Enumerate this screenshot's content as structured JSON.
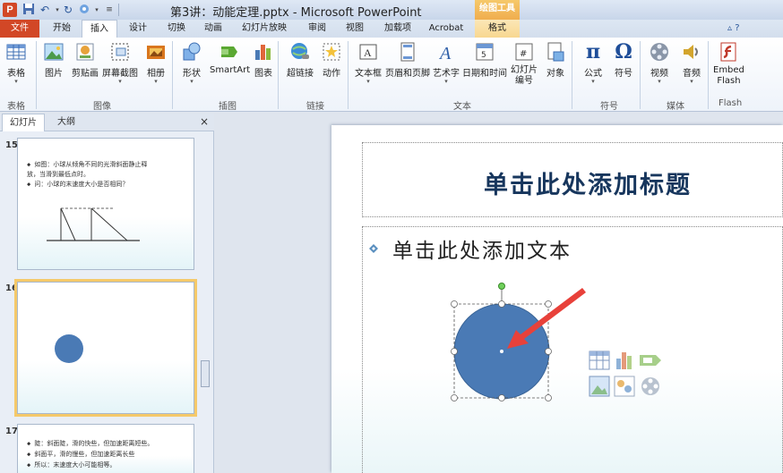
{
  "titlebar": {
    "title": "第3讲：动能定理.pptx - Microsoft PowerPoint",
    "context_group": "绘图工具"
  },
  "tabs": [
    {
      "label": "文件"
    },
    {
      "label": "开始"
    },
    {
      "label": "插入"
    },
    {
      "label": "设计"
    },
    {
      "label": "切换"
    },
    {
      "label": "动画"
    },
    {
      "label": "幻灯片放映"
    },
    {
      "label": "审阅"
    },
    {
      "label": "视图"
    },
    {
      "label": "加载项"
    },
    {
      "label": "Acrobat"
    },
    {
      "label": "格式"
    }
  ],
  "ribbon": {
    "buttons": {
      "table": "表格",
      "picture": "图片",
      "clipart": "剪贴画",
      "screenshot": "屏幕截图",
      "album": "相册",
      "shapes": "形状",
      "smartart": "SmartArt",
      "chart": "图表",
      "hyperlink": "超链接",
      "action": "动作",
      "textbox": "文本框",
      "headerfooter": "页眉和页脚",
      "wordart": "艺术字",
      "datetime": "日期和时间",
      "slidenum_1": "幻灯片",
      "slidenum_2": "编号",
      "object": "对象",
      "equation": "公式",
      "symbol": "符号",
      "video": "视频",
      "audio": "音频",
      "embed_1": "Embed",
      "embed_2": "Flash"
    },
    "groups": {
      "tables": "表格",
      "images": "图像",
      "illustrations": "插图",
      "links": "链接",
      "text": "文本",
      "symbols": "符号",
      "media": "媒体",
      "flash": "Flash"
    }
  },
  "leftpanel": {
    "tabs": {
      "slides": "幻灯片",
      "outline": "大纲"
    },
    "close": "×",
    "slides": [
      {
        "num": "15",
        "lines": [
          "◆ 如图：小球从倾角不同的光滑斜面静止释",
          "  放，当滑到最低点时。",
          "◆ 问：小球的末速度大小是否相同？"
        ]
      },
      {
        "num": "16"
      },
      {
        "num": "17",
        "lines": [
          "◆ 陡：斜面陡，滑的快些，但加速距离短些。",
          "◆    斜面平，滑的慢些，但加速距离长些",
          "◆ 所以：末速度大小可能相等。"
        ]
      }
    ]
  },
  "slide": {
    "title_placeholder": "单击此处添加标题",
    "body_placeholder": "单击此处添加文本",
    "circle_color": "#4a7ab5",
    "arrow_color": "#e8413a"
  }
}
